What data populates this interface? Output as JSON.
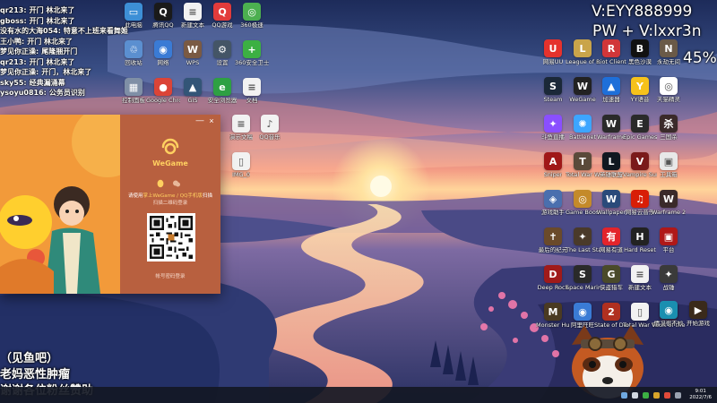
{
  "overlay": {
    "contact_v": "V:EYY888999",
    "contact_pw": "PW + V:lxxr3n",
    "percent": "45%",
    "bottom_lines": [
      "（见鱼吧）",
      "老妈恶性肿瘤",
      "谢谢各位粉丝赞助"
    ]
  },
  "chat": [
    {
      "user": "qr213:",
      "msg": "开门 林北来了"
    },
    {
      "user": "gboss:",
      "msg": "开门 林北来了"
    },
    {
      "user": "没有水的大海054:",
      "msg": "特意不上班来看舞姬"
    },
    {
      "user": "王小鸭:",
      "msg": "开门 林北来了"
    },
    {
      "user": "梦见你正澡:",
      "msg": "尾隆捆开门"
    },
    {
      "user": "qr213:",
      "msg": "开门 林北来了"
    },
    {
      "user": "梦见你正澡:",
      "msg": "开门，林北来了"
    },
    {
      "user": "sky55:",
      "msg": "经典漏涌幕"
    },
    {
      "user": "ysoyu0816:",
      "msg": "公务员识别"
    }
  ],
  "desktop": {
    "left_icons": [
      {
        "label": "此电脑",
        "icon": "computer-icon",
        "color": "#3d8fd6",
        "glyph": "▭"
      },
      {
        "label": "腾讯QQ",
        "icon": "qq-icon",
        "color": "#1a1a1a",
        "glyph": "Q"
      },
      {
        "label": "新建文本",
        "icon": "text-file-icon",
        "color": "#f2f2f2",
        "glyph": "≡"
      },
      {
        "label": "QQ游戏",
        "icon": "qq-game-icon",
        "color": "#e23b3b",
        "glyph": "Q"
      },
      {
        "label": "360极速",
        "icon": "browser-360-icon",
        "color": "#4caf50",
        "glyph": "◎"
      },
      {
        "label": "回收站",
        "icon": "recycle-bin-icon",
        "color": "#5b8fd0",
        "glyph": "♲"
      },
      {
        "label": "网络",
        "icon": "network-icon",
        "color": "#3a7bd5",
        "glyph": "◉"
      },
      {
        "label": "WPS",
        "icon": "wps-icon",
        "color": "#7a5a44",
        "glyph": "W"
      },
      {
        "label": "设置",
        "icon": "settings-icon",
        "color": "#445566",
        "glyph": "⚙"
      },
      {
        "label": "360安全卫士",
        "icon": "security-360-icon",
        "color": "#3cb043",
        "glyph": "+"
      },
      {
        "label": "控制面板",
        "icon": "control-panel-icon",
        "color": "#7f8fa6",
        "glyph": "▦"
      },
      {
        "label": "Google Chrome",
        "icon": "chrome-icon",
        "color": "#db4437",
        "glyph": "●"
      },
      {
        "label": "GIS",
        "icon": "gis-icon",
        "color": "#335577",
        "glyph": "▲"
      },
      {
        "label": "安全浏览器",
        "icon": "safe-browser-icon",
        "color": "#2ea043",
        "glyph": "e"
      },
      {
        "label": "文档",
        "icon": "document-icon",
        "color": "#f2f2f2",
        "glyph": "≡"
      },
      {
        "label": "演示文稿",
        "icon": "slides-icon",
        "color": "#f2f2f2",
        "glyph": "≡"
      },
      {
        "label": "QQ音乐",
        "icon": "qq-music-icon",
        "color": "#f2f2f2",
        "glyph": "♪"
      },
      {
        "label": "IMG_0",
        "icon": "image-file-icon",
        "color": "#f2f2f2",
        "glyph": "▯"
      }
    ],
    "right_icons": [
      {
        "label": "网易UU",
        "icon": "uu-booster-icon",
        "color": "#e5322d",
        "glyph": "U"
      },
      {
        "label": "League of Legends",
        "icon": "lol-icon",
        "color": "#c9a44a",
        "glyph": "L"
      },
      {
        "label": "Riot Client",
        "icon": "riot-icon",
        "color": "#d13639",
        "glyph": "R"
      },
      {
        "label": "黑色沙漠",
        "icon": "black-desert-icon",
        "color": "#111111",
        "glyph": "B"
      },
      {
        "label": "永劫无间",
        "icon": "naraka-icon",
        "color": "#6a5a48",
        "glyph": "N"
      },
      {
        "label": "Steam",
        "icon": "steam-icon",
        "color": "#1b2838",
        "glyph": "S"
      },
      {
        "label": "WeGame",
        "icon": "wegame-icon",
        "color": "#222222",
        "glyph": "W"
      },
      {
        "label": "加速器",
        "icon": "accelerator-icon",
        "color": "#1e6fd9",
        "glyph": "▲"
      },
      {
        "label": "YY语音",
        "icon": "yy-icon",
        "color": "#f6c21b",
        "glyph": "Y"
      },
      {
        "label": "天猫精灵",
        "icon": "camera-icon",
        "color": "#ffffff",
        "glyph": "◎"
      },
      {
        "label": "斗鱼直播",
        "icon": "douyu-icon",
        "color": "#8a4fff",
        "glyph": "✦"
      },
      {
        "label": "Battlenet",
        "icon": "battlenet-icon",
        "color": "#3da5ff",
        "glyph": "✺"
      },
      {
        "label": "Warframe",
        "icon": "warframe-icon",
        "color": "#2a2a2a",
        "glyph": "W"
      },
      {
        "label": "Epic Games",
        "icon": "epic-icon",
        "color": "#2a2a2a",
        "glyph": "E"
      },
      {
        "label": "三国杀",
        "icon": "sanguosha-icon",
        "color": "#3a2a2a",
        "glyph": "杀"
      },
      {
        "label": "Sniper",
        "icon": "sniper-icon",
        "color": "#a01818",
        "glyph": "A"
      },
      {
        "label": "Total War WARHA",
        "icon": "warhammer-icon",
        "color": "#5a4a3a",
        "glyph": "T"
      },
      {
        "label": "英雄联盟",
        "icon": "lol-client-icon",
        "color": "#101820",
        "glyph": "L"
      },
      {
        "label": "Vampire Survivors",
        "icon": "vampire-icon",
        "color": "#7a1a1a",
        "glyph": "V"
      },
      {
        "label": "工具箱",
        "icon": "toolbox-icon",
        "color": "#e8e8e8",
        "glyph": "▣"
      },
      {
        "label": "游戏助手",
        "icon": "game-helper-icon",
        "color": "#4a6fae",
        "glyph": "◈"
      },
      {
        "label": "Game Booster",
        "icon": "booster-icon",
        "color": "#c48a2a",
        "glyph": "◎"
      },
      {
        "label": "Wallpaper",
        "icon": "wallpaper-icon",
        "color": "#2a4a7a",
        "glyph": "W"
      },
      {
        "label": "网易云音乐",
        "icon": "netease-music-icon",
        "color": "#d81e06",
        "glyph": "♫"
      },
      {
        "label": "Warframe 2.0",
        "icon": "warframe2-icon",
        "color": "#3a2a2a",
        "glyph": "W"
      },
      {
        "label": "最后的纪元",
        "icon": "last-epoch-icon",
        "color": "#6a4a2a",
        "glyph": "✝"
      },
      {
        "label": "The Last Stand",
        "icon": "last-stand-icon",
        "color": "#4a3a2a",
        "glyph": "✦"
      },
      {
        "label": "网易有道",
        "icon": "youdao-icon",
        "color": "#e3242b",
        "glyph": "有"
      },
      {
        "label": "Hard Reset",
        "icon": "hard-reset-icon",
        "color": "#222222",
        "glyph": "H"
      },
      {
        "label": "平台",
        "icon": "platform-icon",
        "color": "#b01818",
        "glyph": "▣"
      },
      {
        "label": "Deep Rock",
        "icon": "deep-rock-icon",
        "color": "#a01a1a",
        "glyph": "D"
      },
      {
        "label": "Space Marine",
        "icon": "space-marine-icon",
        "color": "#2a2a2a",
        "glyph": "S"
      },
      {
        "label": "侠盗猎车",
        "icon": "gta-icon",
        "color": "#4a4a2a",
        "glyph": "G"
      },
      {
        "label": "新建文本",
        "icon": "text-file-icon",
        "color": "#f2f2f2",
        "glyph": "≡"
      },
      {
        "label": "战锤",
        "icon": "warhammer2-icon",
        "color": "#3a3a3a",
        "glyph": "✦"
      },
      {
        "label": "Monster Hunter",
        "icon": "monster-hunter-icon",
        "color": "#4a3a22",
        "glyph": "M"
      },
      {
        "label": "阿里旺旺",
        "icon": "aliwangwang-icon",
        "color": "#3a7bd5",
        "glyph": "◉"
      },
      {
        "label": "State of Decay 2",
        "icon": "state-of-decay-icon",
        "color": "#b03020",
        "glyph": "2"
      },
      {
        "label": "Total War THREE",
        "icon": "total-war-three-icon",
        "color": "#f2f2f2",
        "glyph": "▯"
      },
      {
        "label": "Vault of the Vo",
        "icon": "vault-icon",
        "color": "#3a2a4a",
        "glyph": "V"
      },
      {
        "label": "情况很不妙",
        "icon": "unknown-game-icon",
        "color": "#1a8fb0",
        "glyph": "◉"
      },
      {
        "label": "开始游戏",
        "icon": "start-game-icon",
        "color": "#3a2a1a",
        "glyph": "▶"
      }
    ]
  },
  "wegame": {
    "brand": "WeGame",
    "tip_prefix": "请使用",
    "tip_highlight": "掌上WeGame / QQ手机版",
    "tip_suffix": "扫描",
    "subtip": "扫描二维码登录",
    "account_login": "帐号密码登录",
    "close_symbol": "×",
    "minimize_symbol": "—",
    "accent_color": "#ffd060"
  },
  "taskbar": {
    "time": "9:01",
    "date": "2022/7/6"
  }
}
